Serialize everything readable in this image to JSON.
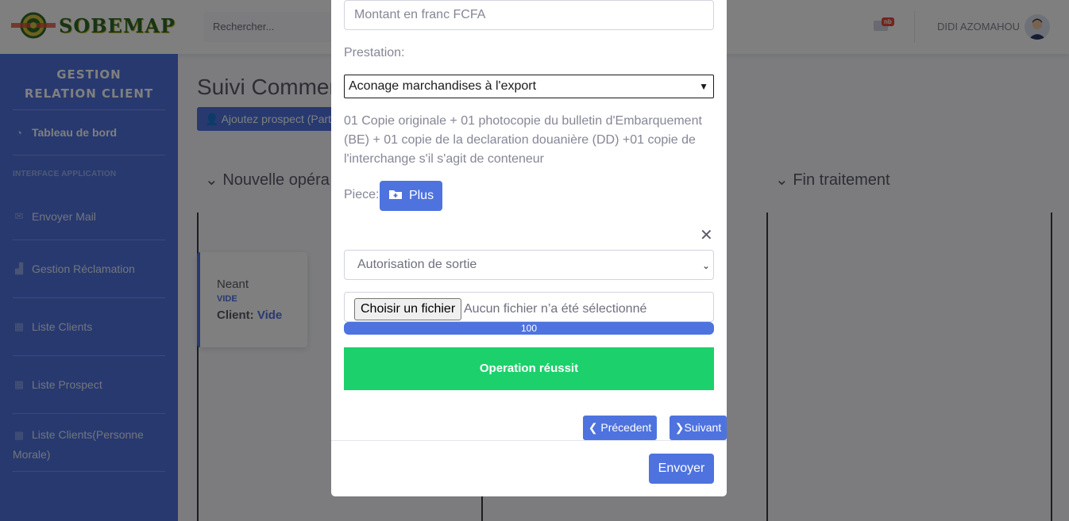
{
  "topbar": {
    "logo_text": "SOBEMAP",
    "search_placeholder": "Rechercher...",
    "notification_badge": "nb",
    "user_name": "DIDI AZOMAHOU"
  },
  "sidebar": {
    "brand_line1": "GESTION",
    "brand_line2": "RELATION CLIENT",
    "dashboard_label": "Tableau de bord",
    "heading": "INTERFACE APPLICATION",
    "items": [
      {
        "label": "Envoyer Mail",
        "icon": "envelope-icon"
      },
      {
        "label": "Gestion Réclamation",
        "icon": "chart-area-icon"
      },
      {
        "label": "Liste Clients",
        "icon": "table-icon"
      },
      {
        "label": "Liste Prospect",
        "icon": "table-icon"
      },
      {
        "label": "Liste Clients(Personne Morale)",
        "icon": "table-icon"
      }
    ]
  },
  "main": {
    "title": "Suivi Commer",
    "add_prospect_label": "Ajoutez prospect (Partic",
    "columns": [
      "Nouvelle opéra",
      "Fin traitement"
    ],
    "card": {
      "title": "Neant",
      "subtitle": "VIDE",
      "client_label": "Client:",
      "client_value": "Vide"
    }
  },
  "modal": {
    "amount_placeholder": "Montant en franc FCFA",
    "prestation_label": "Prestation:",
    "prestation_value": "Aconage marchandises à l'export",
    "description": "01 Copie originale + 01 photocopie du bulletin d'Embarquement (BE) + 01 copie de la declaration douanière (DD) +01 copie de l'interchange s'il s'agit de conteneur",
    "piece_label": "Piece:",
    "plus_label": "Plus",
    "document_type": "Autorisation de sortie",
    "file_button": "Choisir un fichier",
    "file_status": "Aucun fichier n’a été sélectionné",
    "progress_text": "100",
    "progress_value": 100,
    "success_message": "Operation réussit",
    "prev_label": "Précedent",
    "next_label": "Suivant",
    "send_label": "Envoyer"
  },
  "colors": {
    "primary": "#4e73df",
    "success": "#1cd16b",
    "sidebar": "#4e73df"
  }
}
